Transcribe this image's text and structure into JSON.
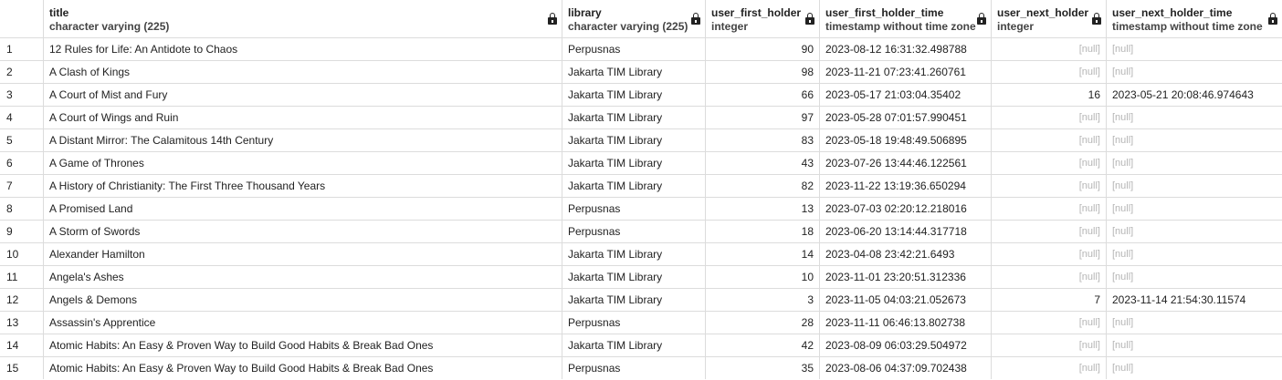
{
  "columns": [
    {
      "name": "",
      "type": ""
    },
    {
      "name": "title",
      "type": "character varying (225)",
      "locked": true
    },
    {
      "name": "library",
      "type": "character varying (225)",
      "locked": true
    },
    {
      "name": "user_first_holder",
      "type": "integer",
      "locked": true
    },
    {
      "name": "user_first_holder_time",
      "type": "timestamp without time zone",
      "locked": true
    },
    {
      "name": "user_next_holder",
      "type": "integer",
      "locked": true
    },
    {
      "name": "user_next_holder_time",
      "type": "timestamp without time zone",
      "locked": true
    }
  ],
  "null_label": "[null]",
  "rows": [
    [
      "1",
      "12 Rules for Life: An Antidote to Chaos",
      "Perpusnas",
      "90",
      "2023-08-12 16:31:32.498788",
      null,
      null
    ],
    [
      "2",
      "A Clash of Kings",
      "Jakarta TIM Library",
      "98",
      "2023-11-21 07:23:41.260761",
      null,
      null
    ],
    [
      "3",
      "A Court of Mist and Fury",
      "Jakarta TIM Library",
      "66",
      "2023-05-17 21:03:04.35402",
      "16",
      "2023-05-21 20:08:46.974643"
    ],
    [
      "4",
      "A Court of Wings and Ruin",
      "Jakarta TIM Library",
      "97",
      "2023-05-28 07:01:57.990451",
      null,
      null
    ],
    [
      "5",
      "A Distant Mirror: The Calamitous 14th Century",
      "Jakarta TIM Library",
      "83",
      "2023-05-18 19:48:49.506895",
      null,
      null
    ],
    [
      "6",
      "A Game of Thrones",
      "Jakarta TIM Library",
      "43",
      "2023-07-26 13:44:46.122561",
      null,
      null
    ],
    [
      "7",
      "A History of Christianity: The First Three Thousand Years",
      "Jakarta TIM Library",
      "82",
      "2023-11-22 13:19:36.650294",
      null,
      null
    ],
    [
      "8",
      "A Promised Land",
      "Perpusnas",
      "13",
      "2023-07-03 02:20:12.218016",
      null,
      null
    ],
    [
      "9",
      "A Storm of Swords",
      "Perpusnas",
      "18",
      "2023-06-20 13:14:44.317718",
      null,
      null
    ],
    [
      "10",
      "Alexander Hamilton",
      "Jakarta TIM Library",
      "14",
      "2023-04-08 23:42:21.6493",
      null,
      null
    ],
    [
      "11",
      "Angela's Ashes",
      "Jakarta TIM Library",
      "10",
      "2023-11-01 23:20:51.312336",
      null,
      null
    ],
    [
      "12",
      "Angels & Demons",
      "Jakarta TIM Library",
      "3",
      "2023-11-05 04:03:21.052673",
      "7",
      "2023-11-14 21:54:30.11574"
    ],
    [
      "13",
      "Assassin's Apprentice",
      "Perpusnas",
      "28",
      "2023-11-11 06:46:13.802738",
      null,
      null
    ],
    [
      "14",
      "Atomic Habits: An Easy & Proven Way to Build Good Habits & Break Bad Ones",
      "Jakarta TIM Library",
      "42",
      "2023-08-09 06:03:29.504972",
      null,
      null
    ],
    [
      "15",
      "Atomic Habits: An Easy & Proven Way to Build Good Habits & Break Bad Ones",
      "Perpusnas",
      "35",
      "2023-08-06 04:37:09.702438",
      null,
      null
    ]
  ]
}
